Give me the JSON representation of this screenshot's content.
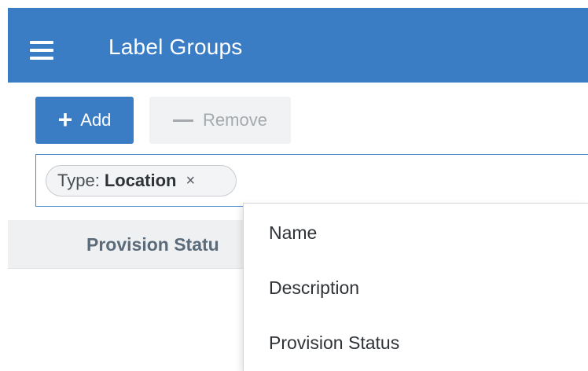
{
  "header": {
    "title": "Label Groups",
    "menu_icon": "hamburger-menu-icon",
    "background_color": "#3a7dc4"
  },
  "toolbar": {
    "add_label": "Add",
    "add_icon": "plus-icon",
    "remove_label": "Remove",
    "remove_icon": "minus-icon"
  },
  "filter": {
    "chip_label": "Type:",
    "chip_value": "Location",
    "chip_close": "×"
  },
  "table": {
    "columns": [
      "Provision Statu"
    ]
  },
  "dropdown": {
    "items": [
      "Name",
      "Description",
      "Provision Status"
    ]
  }
}
